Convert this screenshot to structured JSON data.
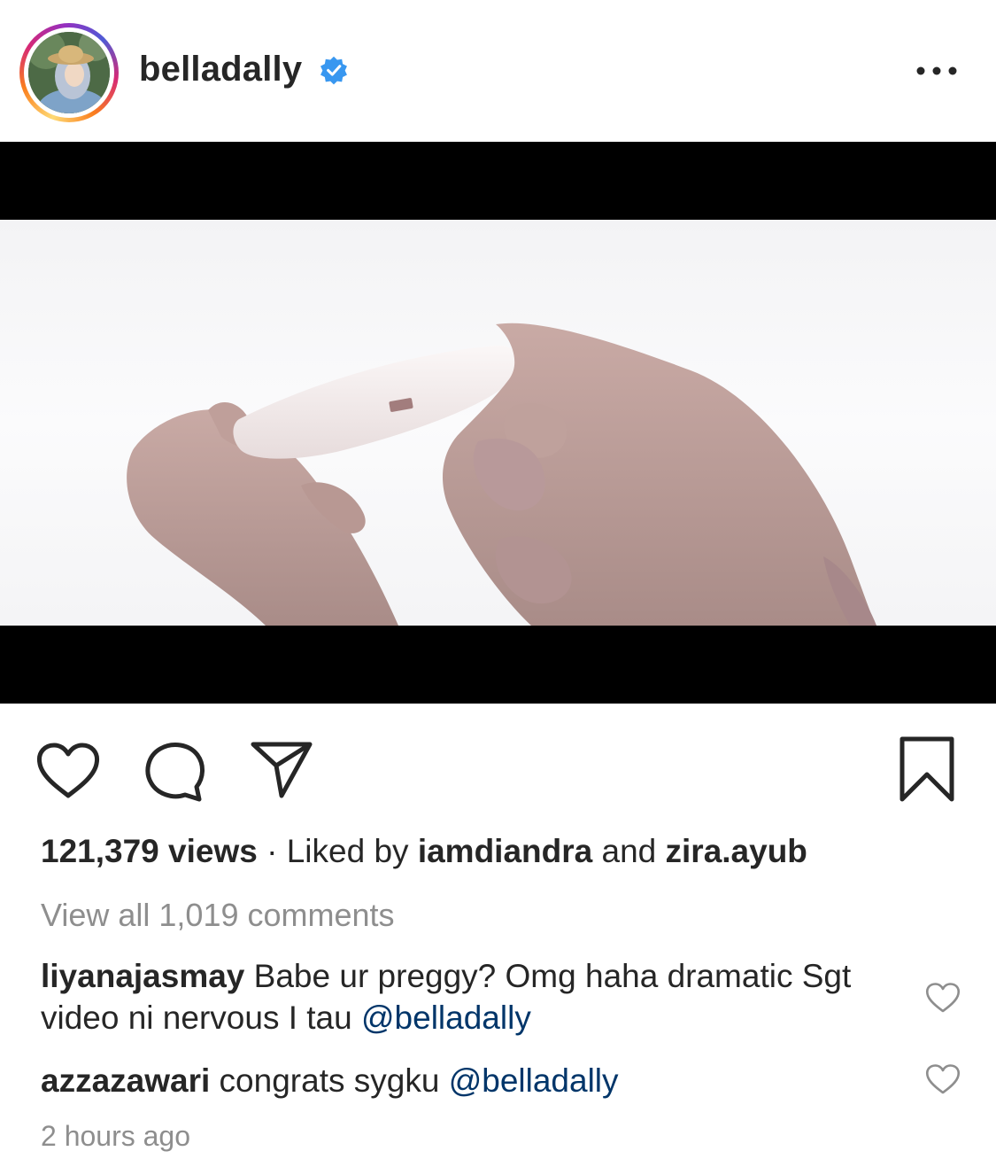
{
  "post": {
    "username": "belladally",
    "verified": true
  },
  "icons": {
    "more": "more-options-icon",
    "like": "heart-icon",
    "comment": "comment-icon",
    "share": "paper-plane-icon",
    "save": "bookmark-icon",
    "verified": "verified-badge-icon"
  },
  "colors": {
    "verified_badge": "#3897f0",
    "mention": "#003569",
    "muted": "#8e8e8e",
    "text": "#262626"
  },
  "stats": {
    "views": "121,379 views",
    "separator": " · ",
    "liked_by_prefix": "Liked by ",
    "liked_by_user1": "iamdiandra",
    "liked_by_and": " and ",
    "liked_by_user2": "zira.ayub"
  },
  "view_all_comments": "View all 1,019 comments",
  "comments": [
    {
      "user": "liyanajasmay",
      "text": " Babe ur preggy? Omg haha dramatic Sgt video ni nervous I tau ",
      "mention": "@belladally"
    },
    {
      "user": "azzazawari",
      "text": " congrats sygku ",
      "mention": "@belladally"
    }
  ],
  "timestamp": "2 hours ago"
}
